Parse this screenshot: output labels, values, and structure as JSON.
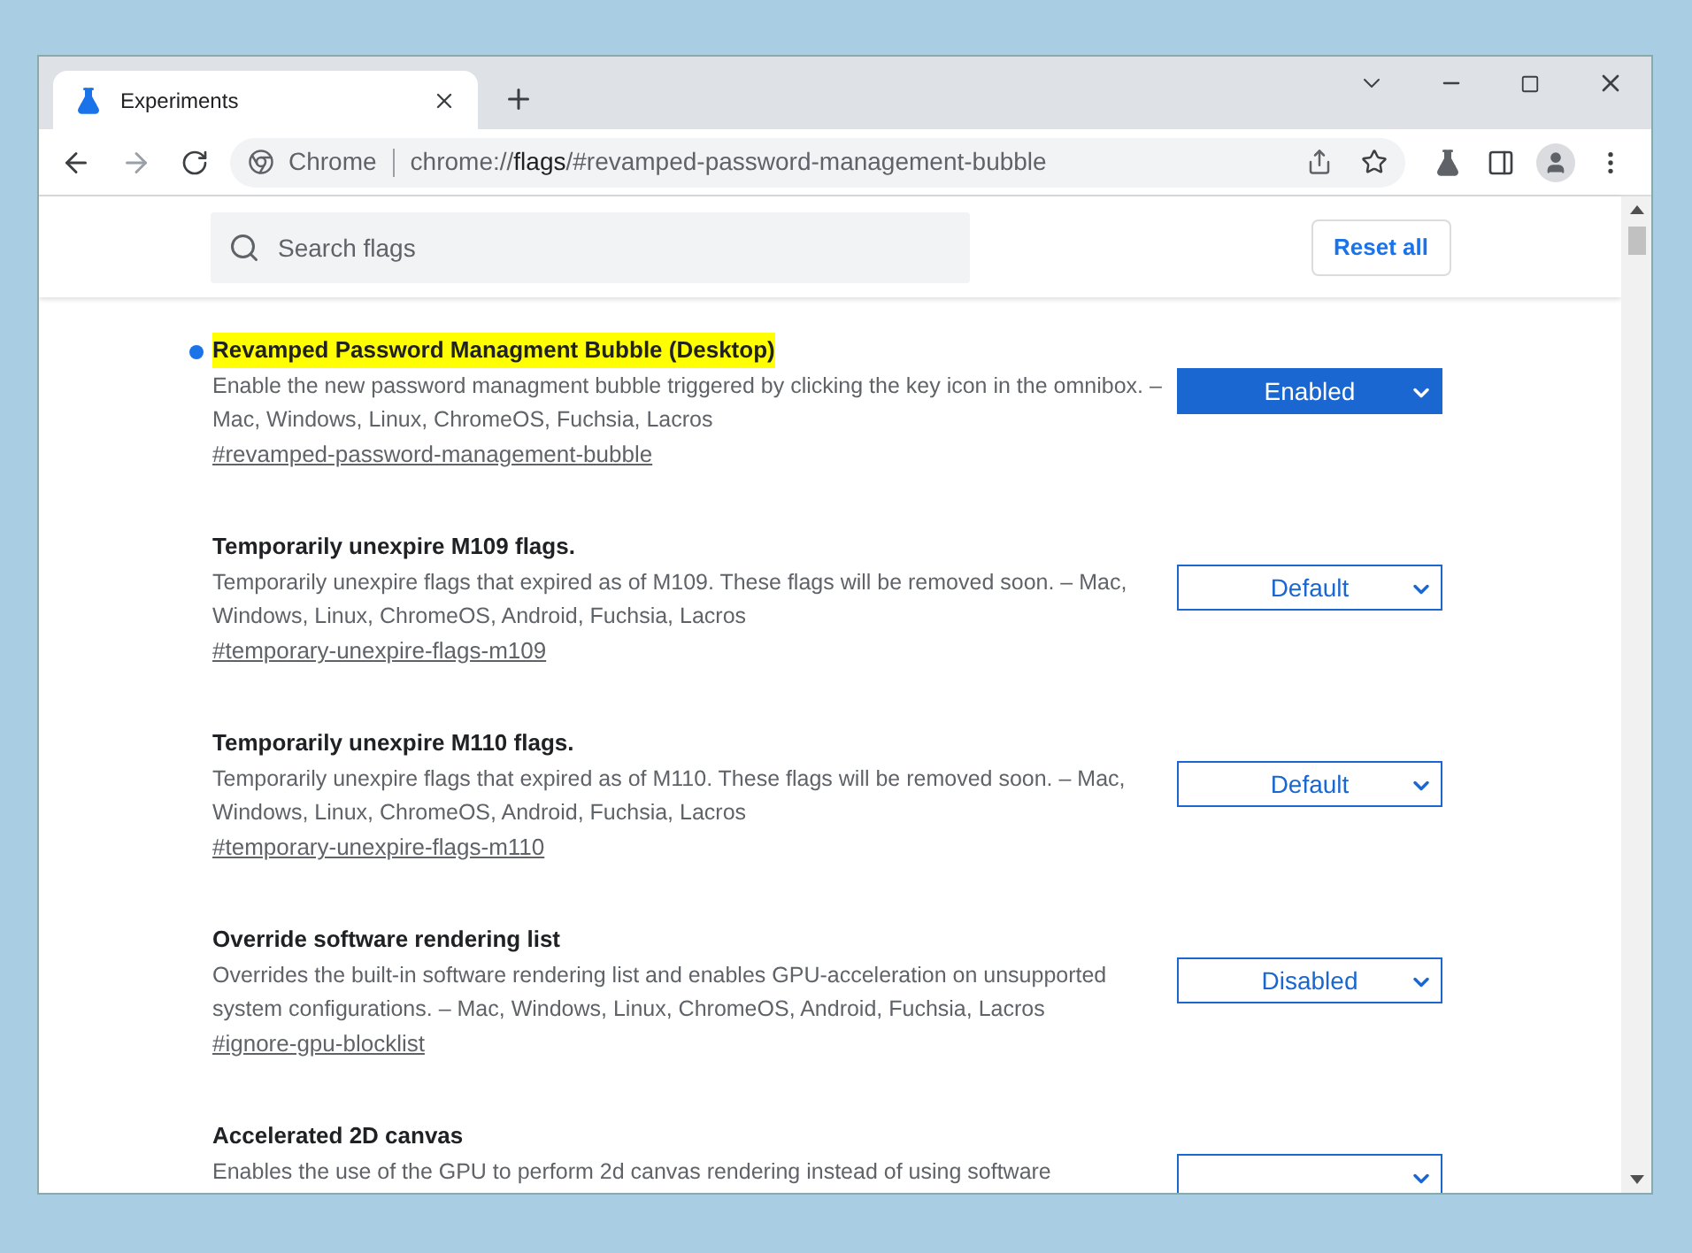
{
  "tab": {
    "title": "Experiments",
    "selected": true
  },
  "address_bar": {
    "site_label": "Chrome",
    "url_prefix": "chrome://",
    "url_host": "flags",
    "url_rest": "/#revamped-password-management-bubble"
  },
  "search": {
    "placeholder": "Search flags"
  },
  "reset_button": "Reset all",
  "flags": [
    {
      "title": "Revamped Password Managment Bubble (Desktop)",
      "modified": true,
      "description": "Enable the new password managment bubble triggered by clicking the key icon in the omnibox. – Mac, Windows, Linux, ChromeOS, Fuchsia, Lacros",
      "link": "#revamped-password-management-bubble",
      "value": "Enabled"
    },
    {
      "title": "Temporarily unexpire M109 flags.",
      "modified": false,
      "description": "Temporarily unexpire flags that expired as of M109. These flags will be removed soon. – Mac, Windows, Linux, ChromeOS, Android, Fuchsia, Lacros",
      "link": "#temporary-unexpire-flags-m109",
      "value": "Default"
    },
    {
      "title": "Temporarily unexpire M110 flags.",
      "modified": false,
      "description": "Temporarily unexpire flags that expired as of M110. These flags will be removed soon. – Mac, Windows, Linux, ChromeOS, Android, Fuchsia, Lacros",
      "link": "#temporary-unexpire-flags-m110",
      "value": "Default"
    },
    {
      "title": "Override software rendering list",
      "modified": false,
      "description": "Overrides the built-in software rendering list and enables GPU-acceleration on unsupported system configurations. – Mac, Windows, Linux, ChromeOS, Android, Fuchsia, Lacros",
      "link": "#ignore-gpu-blocklist",
      "value": "Disabled"
    },
    {
      "title": "Accelerated 2D canvas",
      "modified": false,
      "description": "Enables the use of the GPU to perform 2d canvas rendering instead of using software"
    }
  ]
}
